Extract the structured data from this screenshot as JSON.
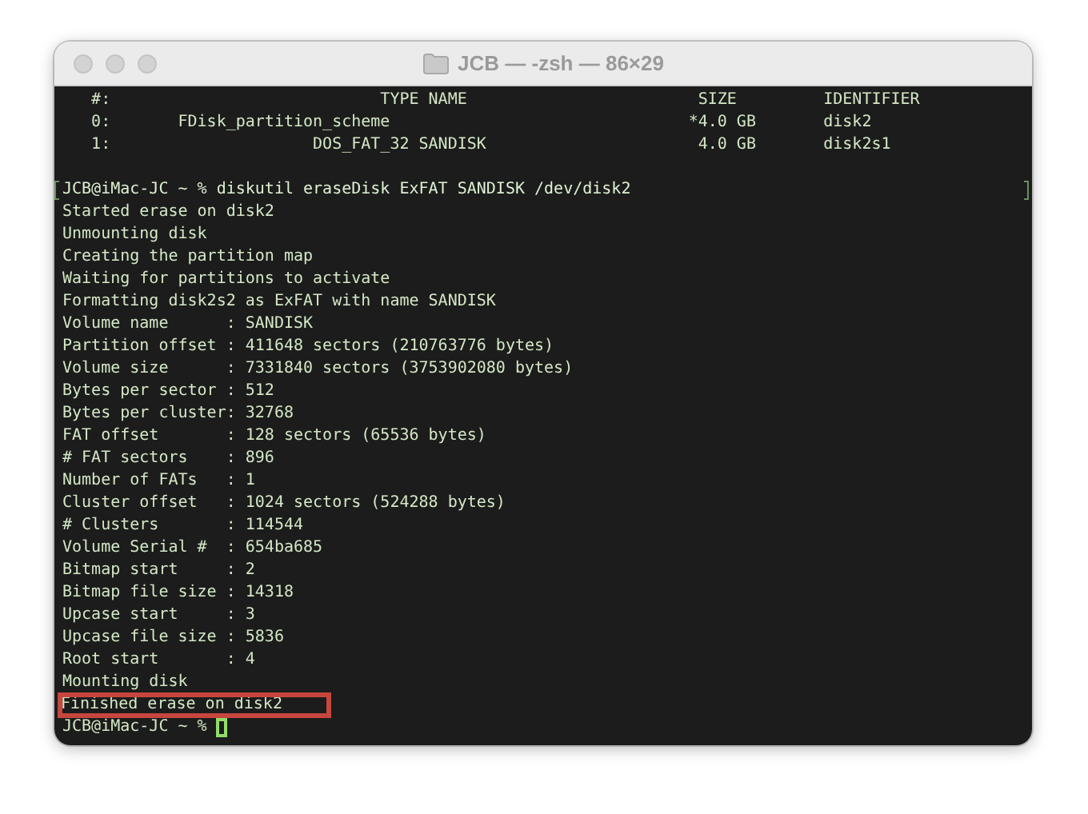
{
  "window": {
    "title": "JCB — -zsh — 86×29"
  },
  "terminal": {
    "header": [
      "   #:                            TYPE NAME                        SIZE         IDENTIFIER",
      "   0:       FDisk_partition_scheme                               *4.0 GB       disk2",
      "   1:                     DOS_FAT_32 SANDISK                      4.0 GB       disk2s1"
    ],
    "lines": [
      {
        "text": "JCB@iMac-JC ~ % diskutil eraseDisk ExFAT SANDISK /dev/disk2",
        "marked": true,
        "highlighted": false
      },
      {
        "text": "Started erase on disk2",
        "marked": false,
        "highlighted": false
      },
      {
        "text": "Unmounting disk",
        "marked": false,
        "highlighted": false
      },
      {
        "text": "Creating the partition map",
        "marked": false,
        "highlighted": false
      },
      {
        "text": "Waiting for partitions to activate",
        "marked": false,
        "highlighted": false
      },
      {
        "text": "Formatting disk2s2 as ExFAT with name SANDISK",
        "marked": false,
        "highlighted": false
      },
      {
        "text": "Volume name      : SANDISK",
        "marked": false,
        "highlighted": false
      },
      {
        "text": "Partition offset : 411648 sectors (210763776 bytes)",
        "marked": false,
        "highlighted": false
      },
      {
        "text": "Volume size      : 7331840 sectors (3753902080 bytes)",
        "marked": false,
        "highlighted": false
      },
      {
        "text": "Bytes per sector : 512",
        "marked": false,
        "highlighted": false
      },
      {
        "text": "Bytes per cluster: 32768",
        "marked": false,
        "highlighted": false
      },
      {
        "text": "FAT offset       : 128 sectors (65536 bytes)",
        "marked": false,
        "highlighted": false
      },
      {
        "text": "# FAT sectors    : 896",
        "marked": false,
        "highlighted": false
      },
      {
        "text": "Number of FATs   : 1",
        "marked": false,
        "highlighted": false
      },
      {
        "text": "Cluster offset   : 1024 sectors (524288 bytes)",
        "marked": false,
        "highlighted": false
      },
      {
        "text": "# Clusters       : 114544",
        "marked": false,
        "highlighted": false
      },
      {
        "text": "Volume Serial #  : 654ba685",
        "marked": false,
        "highlighted": false
      },
      {
        "text": "Bitmap start     : 2",
        "marked": false,
        "highlighted": false
      },
      {
        "text": "Bitmap file size : 14318",
        "marked": false,
        "highlighted": false
      },
      {
        "text": "Upcase start     : 3",
        "marked": false,
        "highlighted": false
      },
      {
        "text": "Upcase file size : 5836",
        "marked": false,
        "highlighted": false
      },
      {
        "text": "Root start       : 4",
        "marked": false,
        "highlighted": false
      },
      {
        "text": "Mounting disk",
        "marked": false,
        "highlighted": false
      },
      {
        "text": "Finished erase on disk2",
        "marked": false,
        "highlighted": true
      }
    ],
    "prompt": {
      "text": "JCB@iMac-JC ~ %",
      "cursor": true
    }
  }
}
